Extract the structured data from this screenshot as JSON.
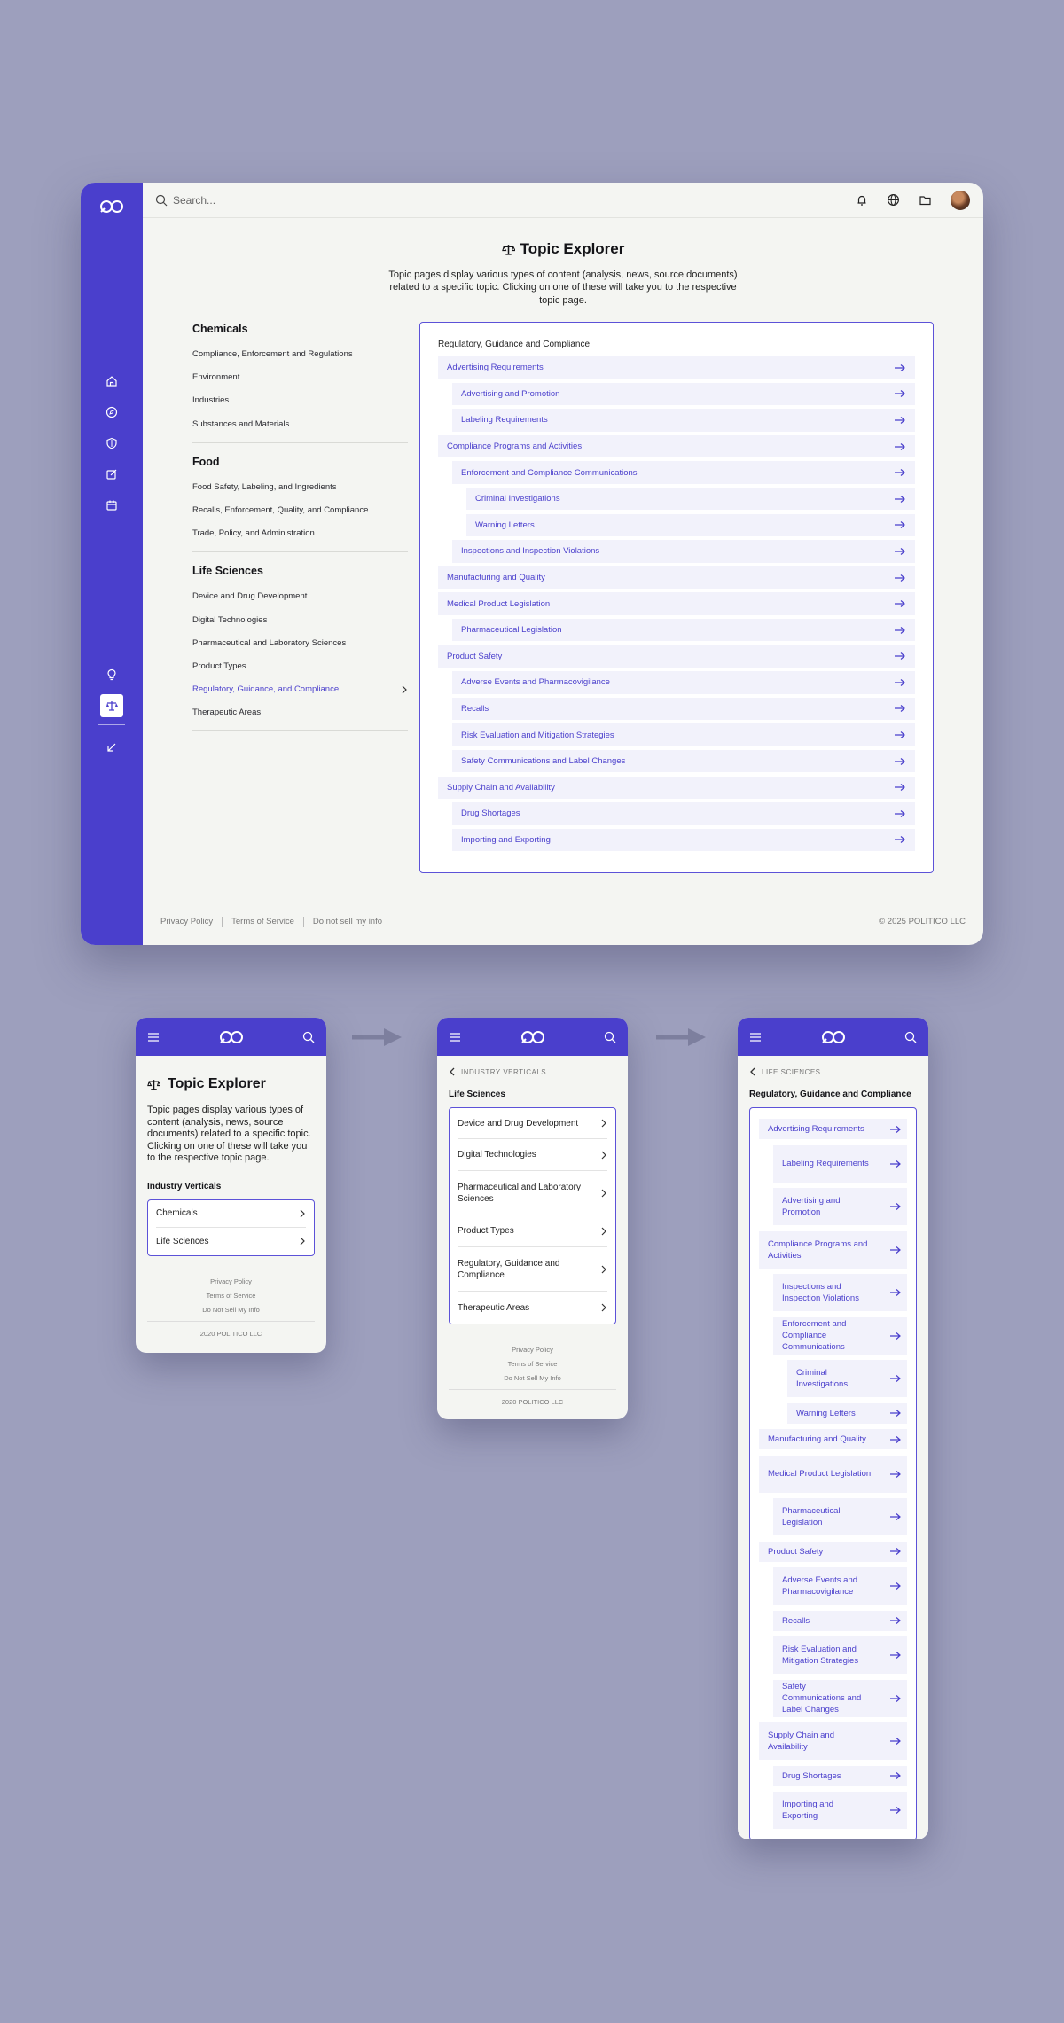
{
  "desktop": {
    "search_placeholder": "Search...",
    "sidebar_icons": [
      "home-icon",
      "compass-icon",
      "shield-icon",
      "edit-icon",
      "calendar-icon",
      "lightbulb-icon",
      "scale-icon",
      "collapse-icon"
    ],
    "title": "Topic Explorer",
    "description": "Topic pages display various types of content (analysis, news, source documents) related to a specific topic. Clicking on one of these will take you to the respective topic page.",
    "groups": [
      {
        "heading": "Chemicals",
        "items": [
          "Compliance, Enforcement and Regulations",
          "Environment",
          "Industries",
          "Substances and Materials"
        ]
      },
      {
        "heading": "Food",
        "items": [
          "Food Safety, Labeling, and Ingredients",
          "Recalls, Enforcement, Quality, and Compliance",
          "Trade, Policy, and Administration"
        ]
      },
      {
        "heading": "Life Sciences",
        "items": [
          "Device and Drug Development",
          "Digital Technologies",
          "Pharmaceutical and Laboratory Sciences",
          "Product Types",
          "Regulatory, Guidance, and Compliance",
          "Therapeutic Areas"
        ]
      }
    ],
    "panel_title": "Regulatory, Guidance and Compliance",
    "tree": [
      {
        "label": "Advertising Requirements",
        "level": 0
      },
      {
        "label": "Advertising and Promotion",
        "level": 1
      },
      {
        "label": "Labeling Requirements",
        "level": 1
      },
      {
        "label": "Compliance Programs and Activities",
        "level": 0
      },
      {
        "label": "Enforcement and Compliance Communications",
        "level": 1
      },
      {
        "label": "Criminal Investigations",
        "level": 2
      },
      {
        "label": "Warning Letters",
        "level": 2
      },
      {
        "label": "Inspections and Inspection Violations",
        "level": 1
      },
      {
        "label": "Manufacturing and Quality",
        "level": 0
      },
      {
        "label": "Medical Product Legislation",
        "level": 0
      },
      {
        "label": "Pharmaceutical Legislation",
        "level": 1
      },
      {
        "label": "Product Safety",
        "level": 0
      },
      {
        "label": "Adverse Events and Pharmacovigilance",
        "level": 1
      },
      {
        "label": "Recalls",
        "level": 1
      },
      {
        "label": "Risk Evaluation and Mitigation Strategies",
        "level": 1
      },
      {
        "label": "Safety Communications and Label Changes",
        "level": 1
      },
      {
        "label": "Supply Chain and Availability",
        "level": 0
      },
      {
        "label": "Drug Shortages",
        "level": 1
      },
      {
        "label": "Importing and Exporting",
        "level": 1
      }
    ],
    "footer": {
      "privacy": "Privacy Policy",
      "terms": "Terms of Service",
      "dnsmi": "Do not sell my info",
      "copyright": "© 2025 POLITICO LLC"
    }
  },
  "mobile1": {
    "title": "Topic Explorer",
    "description": "Topic pages display various types of content (analysis, news, source documents) related to a specific topic. Clicking on one of these will take you to the respective topic page.",
    "section": "Industry Verticals",
    "items": [
      "Chemicals",
      "Life Sciences"
    ]
  },
  "mobile2": {
    "back": "INDUSTRY VERTICALS",
    "section": "Life Sciences",
    "items": [
      "Device and Drug Development",
      "Digital Technologies",
      "Pharmaceutical and Laboratory Sciences",
      "Product Types",
      "Regulatory, Guidance and Compliance",
      "Therapeutic Areas"
    ]
  },
  "mobile3": {
    "back": "LIFE SCIENCES",
    "section": "Regulatory, Guidance and Compliance",
    "tree": [
      {
        "label": "Advertising Requirements",
        "level": 0
      },
      {
        "label": "Labeling Requirements",
        "level": 1
      },
      {
        "label": "Advertising and Promotion",
        "level": 1
      },
      {
        "label": "Compliance Programs and Activities",
        "level": 0
      },
      {
        "label": "Inspections and Inspection Violations",
        "level": 1
      },
      {
        "label": "Enforcement and Compliance Communications",
        "level": 1
      },
      {
        "label": "Criminal Investigations",
        "level": 2
      },
      {
        "label": "Warning Letters",
        "level": 2
      },
      {
        "label": "Manufacturing and Quality",
        "level": 0
      },
      {
        "label": "Medical Product Legislation",
        "level": 0
      },
      {
        "label": "Pharmaceutical Legislation",
        "level": 1
      },
      {
        "label": "Product Safety",
        "level": 0
      },
      {
        "label": "Adverse Events and Pharmacovigilance",
        "level": 1
      },
      {
        "label": "Recalls",
        "level": 1
      },
      {
        "label": "Risk Evaluation and Mitigation Strategies",
        "level": 1
      },
      {
        "label": "Safety Communications and Label Changes",
        "level": 1
      },
      {
        "label": "Supply Chain and Availability",
        "level": 0
      },
      {
        "label": "Drug Shortages",
        "level": 1
      },
      {
        "label": "Importing and Exporting",
        "level": 1
      }
    ]
  },
  "mobile_footer": {
    "privacy": "Privacy Policy",
    "terms": "Terms of Service",
    "dnsmi": "Do Not Sell My Info",
    "copyright": "2020 POLITICO LLC"
  },
  "colors": {
    "brand": "#4a3fcc",
    "background": "#9d9fbd",
    "surface": "#f4f5f2",
    "row": "#f2f2fb"
  }
}
